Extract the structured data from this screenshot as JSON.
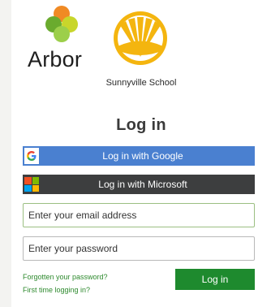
{
  "brand": {
    "name": "Arbor",
    "school_name": "Sunnyville School"
  },
  "title": "Log in",
  "sso": {
    "google_label": "Log in with Google",
    "microsoft_label": "Log in with Microsoft"
  },
  "form": {
    "email_placeholder": "Enter your email address",
    "password_placeholder": "Enter your password",
    "submit_label": "Log in"
  },
  "links": {
    "forgot_password": "Forgotten your password?",
    "first_time": "First time logging in?"
  },
  "colors": {
    "google_button": "#4a80d0",
    "microsoft_button": "#3d3e3f",
    "login_button": "#1e8a2e",
    "link": "#2e8a2e"
  },
  "icons": [
    "arbor-logo",
    "sunnyville-school-logo",
    "google-icon",
    "microsoft-icon"
  ]
}
